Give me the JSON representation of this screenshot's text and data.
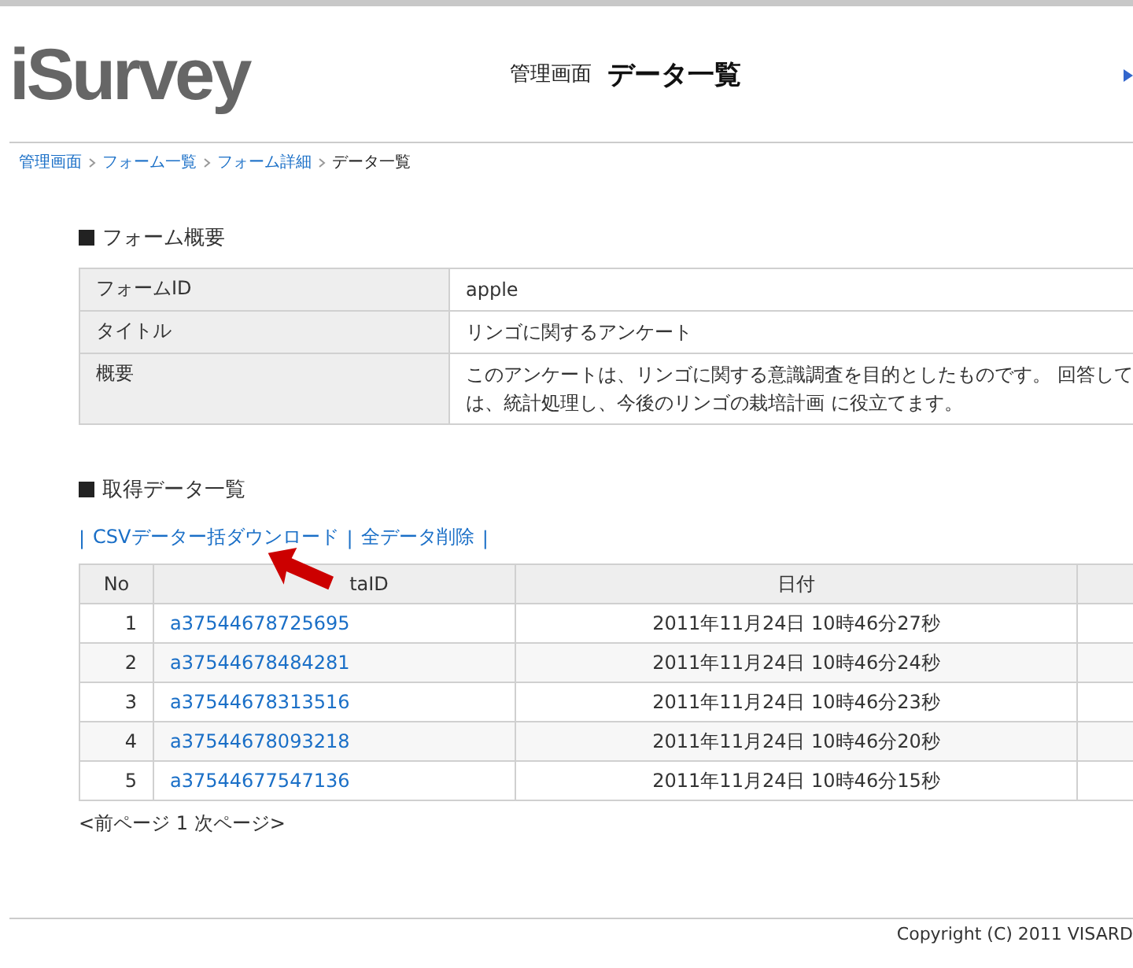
{
  "header": {
    "logo": "iSurvey",
    "section": "管理画面",
    "title": "データ一覧"
  },
  "breadcrumb": [
    {
      "label": "管理画面",
      "link": true
    },
    {
      "label": "フォーム一覧",
      "link": true
    },
    {
      "label": "フォーム詳細",
      "link": true
    },
    {
      "label": "データ一覧",
      "link": false
    }
  ],
  "overview": {
    "heading": "フォーム概要",
    "rows": [
      {
        "label": "フォームID",
        "lines": [
          "apple"
        ]
      },
      {
        "label": "タイトル",
        "lines": [
          "リンゴに関するアンケート"
        ]
      },
      {
        "label": "概要",
        "lines": [
          "このアンケートは、リンゴに関する意識調査を目的としたものです。 回答して",
          "は、統計処理し、今後のリンゴの栽培計画 に役立てます。"
        ]
      }
    ]
  },
  "data_list": {
    "heading": "取得データ一覧",
    "separator": "|",
    "actions": [
      "CSVデーター括ダウンロード",
      "全データ削除"
    ],
    "columns": [
      "No",
      "taID",
      "日付"
    ],
    "rows": [
      {
        "no": "1",
        "id": "a37544678725695",
        "date": "2011年11月24日 10時46分27秒"
      },
      {
        "no": "2",
        "id": "a37544678484281",
        "date": "2011年11月24日 10時46分24秒"
      },
      {
        "no": "3",
        "id": "a37544678313516",
        "date": "2011年11月24日 10時46分23秒"
      },
      {
        "no": "4",
        "id": "a37544678093218",
        "date": "2011年11月24日 10時46分20秒"
      },
      {
        "no": "5",
        "id": "a37544677547136",
        "date": "2011年11月24日 10時46分15秒"
      }
    ],
    "pager": "<前ページ 1 次ページ>"
  },
  "footer": {
    "copyright": "Copyright (C) 2011 VISARD"
  }
}
